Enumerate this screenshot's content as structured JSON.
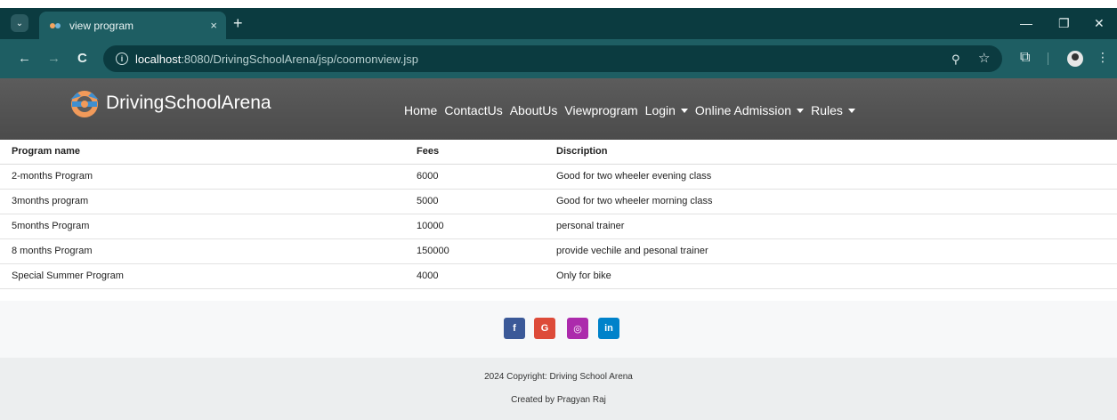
{
  "browser": {
    "tab_title": "view program",
    "tab_close": "×",
    "new_tab": "+",
    "url_host": "localhost",
    "url_rest": ":8080/DrivingSchoolArena/jsp/coomonview.jsp",
    "window_controls": [
      "—",
      "❐",
      "✕"
    ]
  },
  "site": {
    "brand": "DrivingSchoolArena",
    "menu": [
      {
        "label": "Home",
        "dropdown": false
      },
      {
        "label": "ContactUs",
        "dropdown": false
      },
      {
        "label": "AboutUs",
        "dropdown": false
      },
      {
        "label": "Viewprogram",
        "dropdown": false
      },
      {
        "label": "Login",
        "dropdown": true
      },
      {
        "label": "Online Admission",
        "dropdown": true
      },
      {
        "label": "Rules",
        "dropdown": true
      }
    ]
  },
  "table": {
    "headers": [
      "Program name",
      "Fees",
      "Discription"
    ],
    "rows": [
      [
        "2-months Program",
        "6000",
        "Good for two wheeler evening class"
      ],
      [
        "3months program",
        "5000",
        "Good for two wheeler morning class"
      ],
      [
        "5months Program",
        "10000",
        "personal trainer"
      ],
      [
        "8 months Program",
        "150000",
        "provide vechile and pesonal trainer"
      ],
      [
        "Special Summer Program",
        "4000",
        "Only for bike"
      ]
    ]
  },
  "footer": {
    "social": [
      {
        "name": "facebook-icon",
        "glyph": "f",
        "color": "#3b5998"
      },
      {
        "name": "google-icon",
        "glyph": "G",
        "color": "#dd4b39"
      },
      {
        "name": "instagram-icon",
        "glyph": "◎",
        "color": "#ac2bac"
      },
      {
        "name": "linkedin-icon",
        "glyph": "in",
        "color": "#0082ca"
      }
    ],
    "copyright": "2024 Copyright: Driving School Arena",
    "credit": "Created by Pragyan Raj"
  }
}
